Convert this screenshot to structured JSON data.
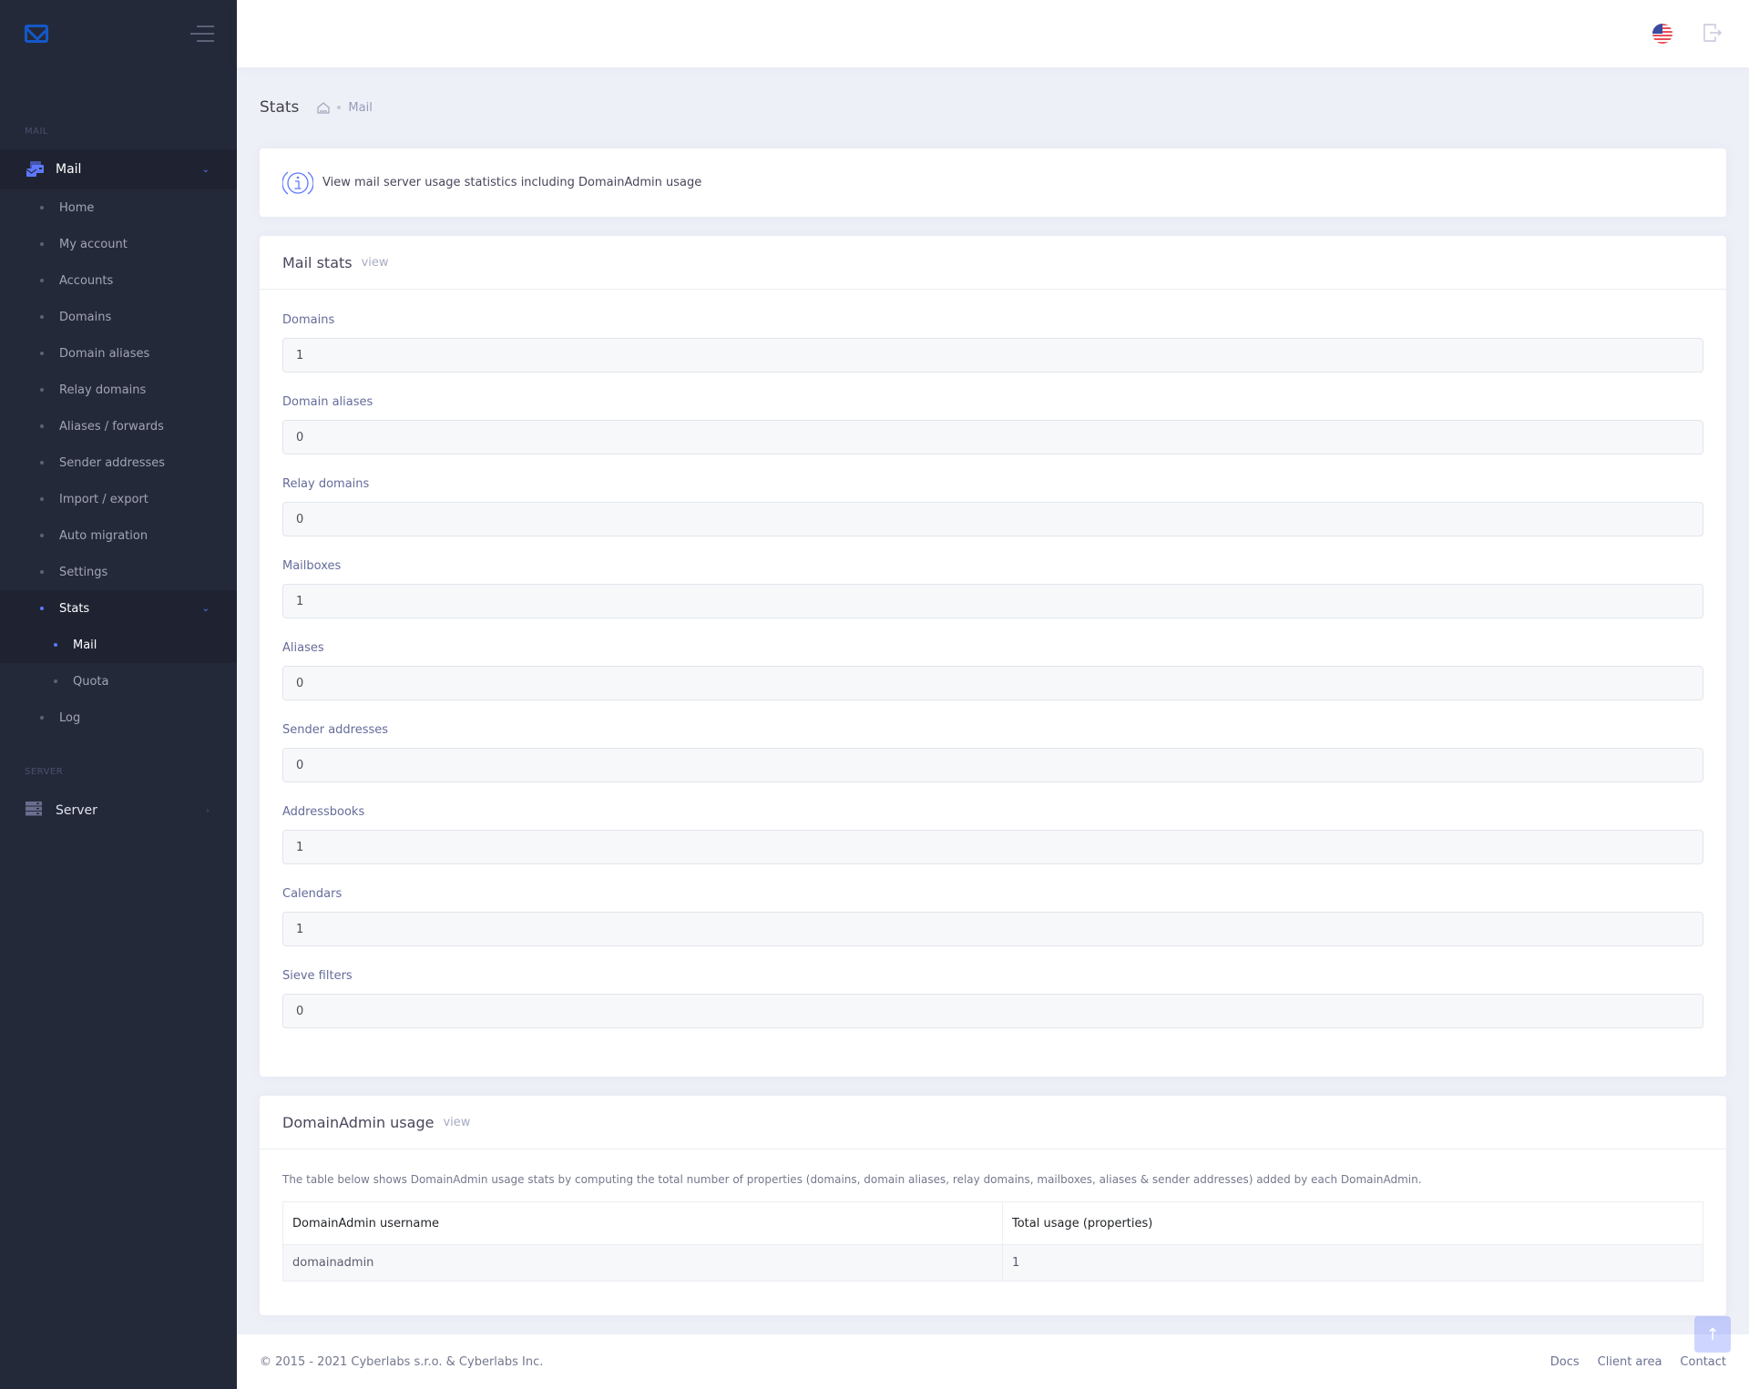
{
  "sidebar": {
    "sections": {
      "mail": "MAIL",
      "server": "SERVER"
    },
    "mail_menu": {
      "label": "Mail",
      "expanded": true
    },
    "items": [
      {
        "label": "Home"
      },
      {
        "label": "My account"
      },
      {
        "label": "Accounts"
      },
      {
        "label": "Domains"
      },
      {
        "label": "Domain aliases"
      },
      {
        "label": "Relay domains"
      },
      {
        "label": "Aliases / forwards"
      },
      {
        "label": "Sender addresses"
      },
      {
        "label": "Import / export"
      },
      {
        "label": "Auto migration"
      },
      {
        "label": "Settings"
      },
      {
        "label": "Stats",
        "active": true,
        "expanded": true
      },
      {
        "label": "Log"
      }
    ],
    "stats_children": [
      {
        "label": "Mail",
        "active": true
      },
      {
        "label": "Quota"
      }
    ],
    "server_menu": {
      "label": "Server"
    }
  },
  "header": {
    "language_icon": "us-flag-icon",
    "logout_icon": "logout-icon"
  },
  "subheader": {
    "title": "Stats",
    "breadcrumb": [
      "home-icon",
      "Mail"
    ]
  },
  "info": {
    "text": "View mail server usage statistics including DomainAdmin usage"
  },
  "mail_stats": {
    "title": "Mail stats",
    "subtitle": "view",
    "fields": [
      {
        "label": "Domains",
        "value": "1"
      },
      {
        "label": "Domain aliases",
        "value": "0"
      },
      {
        "label": "Relay domains",
        "value": "0"
      },
      {
        "label": "Mailboxes",
        "value": "1"
      },
      {
        "label": "Aliases",
        "value": "0"
      },
      {
        "label": "Sender addresses",
        "value": "0"
      },
      {
        "label": "Addressbooks",
        "value": "1"
      },
      {
        "label": "Calendars",
        "value": "1"
      },
      {
        "label": "Sieve filters",
        "value": "0"
      }
    ]
  },
  "domainadmin_usage": {
    "title": "DomainAdmin usage",
    "subtitle": "view",
    "description": "The table below shows DomainAdmin usage stats by computing the total number of properties (domains, domain aliases, relay domains, mailboxes, aliases & sender addresses) added by each DomainAdmin.",
    "columns": [
      "DomainAdmin username",
      "Total usage (properties)"
    ],
    "rows": [
      [
        "domainadmin",
        "1"
      ]
    ]
  },
  "footer": {
    "copyright": "© 2015 - 2021 Cyberlabs s.r.o. & Cyberlabs Inc.",
    "links": [
      "Docs",
      "Client area",
      "Contact"
    ]
  },
  "colors": {
    "accent": "#5d78ff",
    "sidebar_bg": "#242939",
    "page_bg": "#eef0f8"
  }
}
